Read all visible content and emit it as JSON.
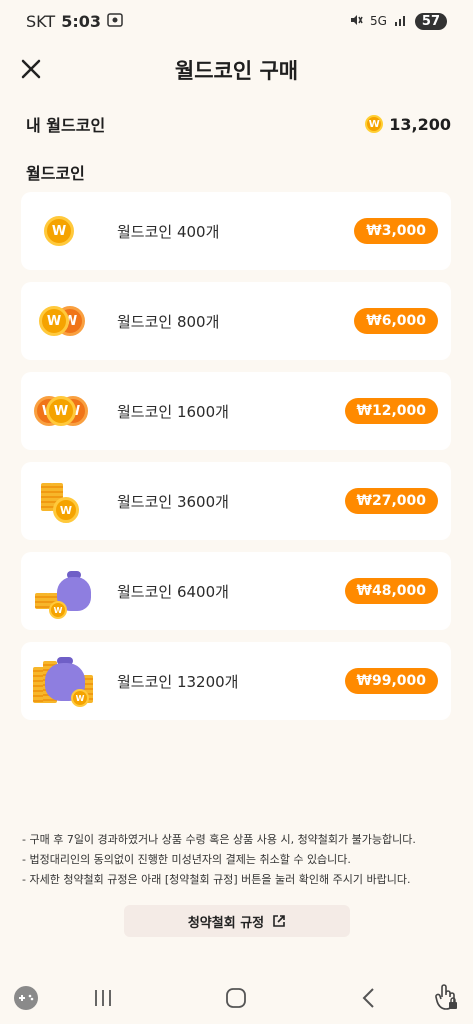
{
  "status_bar": {
    "carrier": "SKT",
    "time": "5:03",
    "network": "5G",
    "battery": "57"
  },
  "header": {
    "title": "월드코인 구매"
  },
  "balance": {
    "label": "내 월드코인",
    "coin_symbol": "W",
    "amount": "13,200"
  },
  "section": {
    "title": "월드코인"
  },
  "products": [
    {
      "name": "월드코인 400개",
      "price": "₩3,000",
      "icon": "single-coin-icon"
    },
    {
      "name": "월드코인 800개",
      "price": "₩6,000",
      "icon": "two-coins-icon"
    },
    {
      "name": "월드코인 1600개",
      "price": "₩12,000",
      "icon": "three-coins-icon"
    },
    {
      "name": "월드코인 3600개",
      "price": "₩27,000",
      "icon": "coin-stack-icon"
    },
    {
      "name": "월드코인 6400개",
      "price": "₩48,000",
      "icon": "money-bag-icon"
    },
    {
      "name": "월드코인 13200개",
      "price": "₩99,000",
      "icon": "big-money-bag-icon"
    }
  ],
  "notes": [
    "- 구매 후 7일이 경과하였거나 상품 수령 혹은 상품 사용 시, 청약철회가 불가능합니다.",
    "- 법정대리인의 동의없이 진행한 미성년자의 결제는 취소할 수 있습니다.",
    "- 자세한 청약철회 규정은 아래 [청약철회 규정] 버튼을 눌러 확인해 주시기 바랍니다."
  ],
  "refund_button": {
    "label": "청약철회 규정"
  },
  "colors": {
    "accent": "#ff8a00",
    "coin": "#f5a300",
    "background": "#fcf8f2"
  }
}
